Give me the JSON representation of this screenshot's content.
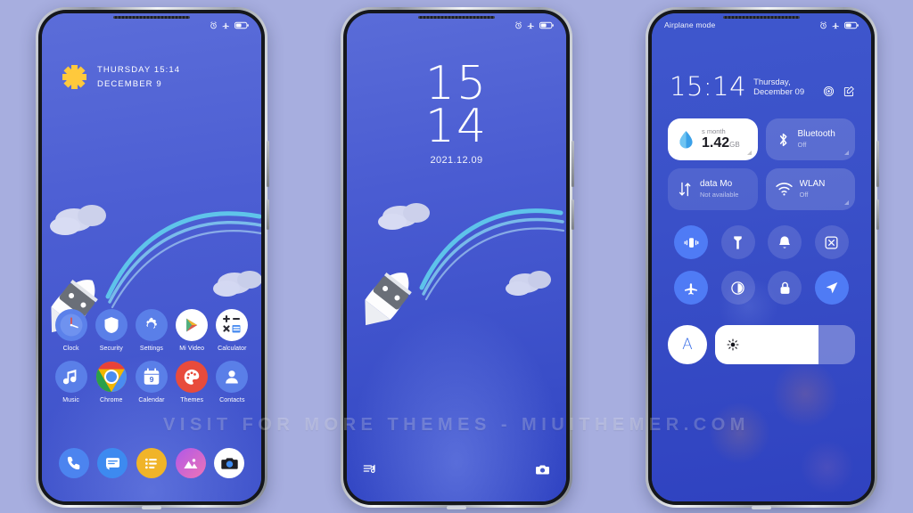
{
  "watermark": "VISIT  FOR  MORE  THEMES  -  MIUITHEMER.COM",
  "theme": {
    "page_bg": "#a7aedf",
    "wallpaper_blue": "#4156c8",
    "accent_blue": "#4f7bf5",
    "icon_blue": "#5a7fe8",
    "sun_yellow": "#ffc93c"
  },
  "phone1": {
    "name": "home-screen",
    "statusbar": {
      "left_text": "",
      "icons": [
        "alarm-icon",
        "airplane-icon",
        "battery-icon"
      ]
    },
    "weather": {
      "icon": "sun-icon",
      "line1": "THURSDAY  15:14",
      "line2": "DECEMBER  9"
    },
    "apps_row1": [
      {
        "label": "Clock",
        "icon": "clock-icon"
      },
      {
        "label": "Security",
        "icon": "shield-icon"
      },
      {
        "label": "Settings",
        "icon": "gear-icon"
      },
      {
        "label": "Mi Video",
        "icon": "play-icon"
      },
      {
        "label": "Calculator",
        "icon": "calculator-icon"
      }
    ],
    "apps_row2": [
      {
        "label": "Music",
        "icon": "music-note-icon"
      },
      {
        "label": "Chrome",
        "icon": "chrome-icon"
      },
      {
        "label": "Calendar",
        "icon": "calendar-icon",
        "day": "9"
      },
      {
        "label": "Themes",
        "icon": "palette-icon"
      },
      {
        "label": "Contacts",
        "icon": "person-icon"
      }
    ],
    "dock": [
      {
        "label": "Phone",
        "icon": "phone-icon"
      },
      {
        "label": "Messages",
        "icon": "message-icon"
      },
      {
        "label": "Notes",
        "icon": "notes-icon"
      },
      {
        "label": "Gallery",
        "icon": "gallery-icon"
      },
      {
        "label": "Camera",
        "icon": "camera-icon"
      }
    ]
  },
  "phone2": {
    "name": "lock-screen",
    "statusbar": {
      "left_text": "",
      "icons": [
        "alarm-icon",
        "airplane-icon",
        "battery-icon"
      ]
    },
    "clock": {
      "hours": "15",
      "minutes": "14",
      "date": "2021.12.09"
    },
    "shortcuts": [
      {
        "label": "Music player",
        "icon": "music-list-icon"
      },
      {
        "label": "Camera",
        "icon": "camera-icon"
      }
    ]
  },
  "phone3": {
    "name": "control-center",
    "statusbar": {
      "left_text": "Airplane mode",
      "icons": [
        "alarm-icon",
        "airplane-icon",
        "battery-icon"
      ]
    },
    "header": {
      "time": "15:14",
      "date": "Thursday, December 09",
      "icons": [
        "settings-gear-icon",
        "edit-icon"
      ]
    },
    "tiles": [
      {
        "name": "data-usage-tile",
        "icon": "data-drop-icon",
        "title": "s month",
        "value": "1.42",
        "unit": "GB",
        "style": "white"
      },
      {
        "name": "bluetooth-tile",
        "icon": "bluetooth-icon",
        "title": "Bluetooth",
        "subtitle": "Off",
        "style": "normal"
      },
      {
        "name": "mobile-data-tile",
        "icon": "data-arrows-icon",
        "title": "data        Mo",
        "subtitle": "Not available",
        "style": "dim"
      },
      {
        "name": "wlan-tile",
        "icon": "wifi-icon",
        "title": "WLAN",
        "subtitle": "Off",
        "style": "normal"
      }
    ],
    "toggles": [
      {
        "name": "vibrate-toggle",
        "icon": "vibrate-icon",
        "state": "on"
      },
      {
        "name": "flashlight-toggle",
        "icon": "flashlight-icon",
        "state": "off"
      },
      {
        "name": "sound-toggle",
        "icon": "bell-icon",
        "state": "off"
      },
      {
        "name": "screenshot-toggle",
        "icon": "screenshot-icon",
        "state": "off"
      },
      {
        "name": "airplane-toggle",
        "icon": "airplane-icon",
        "state": "on"
      },
      {
        "name": "dark-mode-toggle",
        "icon": "contrast-icon",
        "state": "off"
      },
      {
        "name": "lock-toggle",
        "icon": "lock-icon",
        "state": "off"
      },
      {
        "name": "location-toggle",
        "icon": "location-icon",
        "state": "on"
      }
    ],
    "brightness": {
      "auto_label": "A",
      "icon": "brightness-sun-icon",
      "level_percent": 74
    }
  }
}
